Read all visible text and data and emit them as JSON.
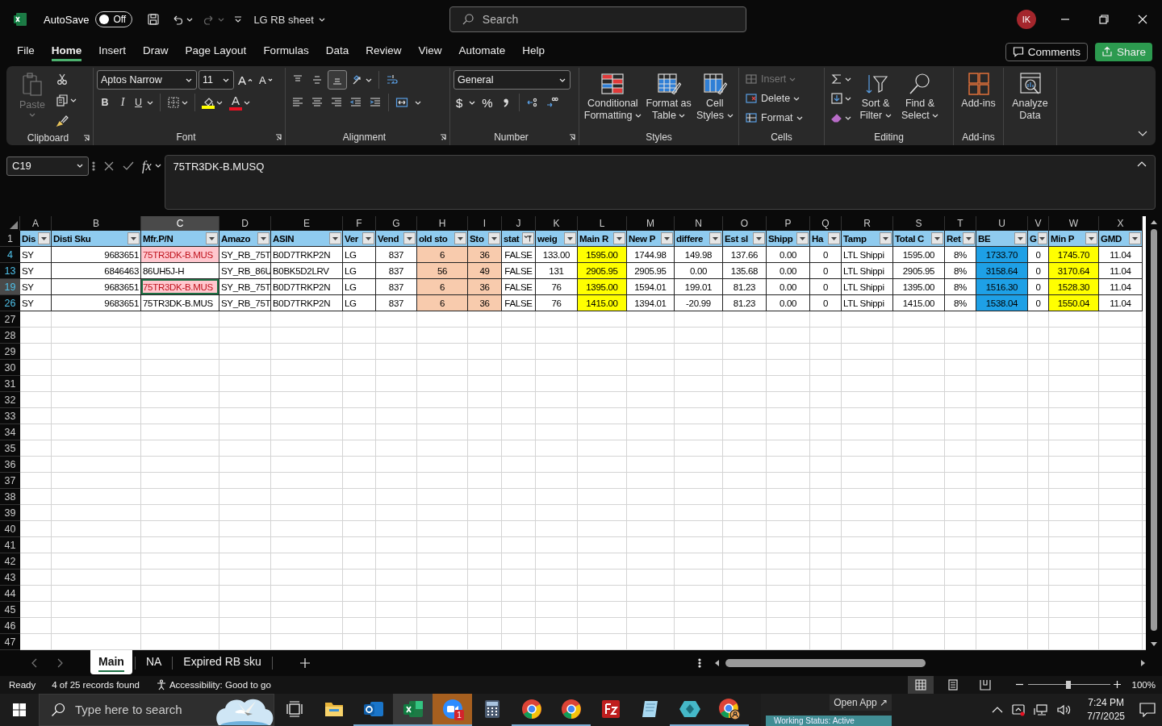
{
  "title_bar": {
    "autosave_label": "AutoSave",
    "autosave": {
      "on": false,
      "label": "Off"
    },
    "document_title": "LG RB sheet",
    "search": {
      "placeholder": "Search"
    },
    "avatar": "IK"
  },
  "menu": {
    "tabs": [
      {
        "label": "File",
        "selected": false
      },
      {
        "label": "Home",
        "selected": true
      },
      {
        "label": "Insert",
        "selected": false
      },
      {
        "label": "Draw",
        "selected": false
      },
      {
        "label": "Page Layout",
        "selected": false
      },
      {
        "label": "Formulas",
        "selected": false
      },
      {
        "label": "Data",
        "selected": false
      },
      {
        "label": "Review",
        "selected": false
      },
      {
        "label": "View",
        "selected": false
      },
      {
        "label": "Automate",
        "selected": false
      },
      {
        "label": "Help",
        "selected": false
      }
    ],
    "comments": "Comments",
    "share": "Share"
  },
  "ribbon": {
    "clipboard": {
      "label": "Clipboard",
      "paste": {
        "label": "Paste",
        "disabled": true
      }
    },
    "font": {
      "label": "Font",
      "font_name": "Aptos Narrow",
      "font_size": "11",
      "grow_font": "A",
      "shrink_font": "A",
      "bold": "B",
      "italic": "I",
      "underline": "U",
      "font_color": "A"
    },
    "alignment": {
      "label": "Alignment"
    },
    "number": {
      "label": "Number",
      "format": "General",
      "currency": "$",
      "percent": "%"
    },
    "styles": {
      "label": "Styles",
      "buttons": [
        "Conditional Formatting",
        "Format as Table",
        "Cell Styles"
      ]
    },
    "cells": {
      "label": "Cells",
      "buttons": [
        {
          "label": "Insert",
          "disabled": true
        },
        {
          "label": "Delete",
          "disabled": false
        },
        {
          "label": "Format",
          "disabled": false
        }
      ]
    },
    "editing": {
      "label": "Editing",
      "buttons": [
        "Sort & Filter",
        "Find & Select"
      ]
    },
    "add_ins": {
      "label": "Add-ins",
      "buttons": [
        "Add-ins"
      ]
    },
    "analysis": {
      "buttons": [
        "Analyze Data"
      ]
    }
  },
  "formula_bar": {
    "name_box": "C19",
    "function_label": "fx",
    "value": "75TR3DK-B.MUSQ"
  },
  "grid": {
    "columns": [
      {
        "letter": "A",
        "selected": false
      },
      {
        "letter": "B",
        "selected": false
      },
      {
        "letter": "C",
        "selected": true
      },
      {
        "letter": "D",
        "selected": false
      },
      {
        "letter": "E",
        "selected": false
      },
      {
        "letter": "F",
        "selected": false
      },
      {
        "letter": "G",
        "selected": false
      },
      {
        "letter": "H",
        "selected": false
      },
      {
        "letter": "I",
        "selected": false
      },
      {
        "letter": "J",
        "selected": false
      },
      {
        "letter": "K",
        "selected": false
      },
      {
        "letter": "L",
        "selected": false
      },
      {
        "letter": "M",
        "selected": false
      },
      {
        "letter": "N",
        "selected": false
      },
      {
        "letter": "O",
        "selected": false
      },
      {
        "letter": "P",
        "selected": false
      },
      {
        "letter": "Q",
        "selected": false
      },
      {
        "letter": "R",
        "selected": false
      },
      {
        "letter": "S",
        "selected": false
      },
      {
        "letter": "T",
        "selected": false
      },
      {
        "letter": "U",
        "selected": false
      },
      {
        "letter": "V",
        "selected": false
      },
      {
        "letter": "W",
        "selected": false
      },
      {
        "letter": "X",
        "selected": false
      }
    ],
    "rows": [
      {
        "number": "1",
        "kind": "header",
        "selected": false,
        "cells": [
          {
            "text": "Dis",
            "filtered": false
          },
          {
            "text": "Disti Sku",
            "filtered": false
          },
          {
            "text": "Mfr.P/N",
            "filtered": false
          },
          {
            "text": "Amazo",
            "filtered": false
          },
          {
            "text": "ASIN",
            "filtered": false
          },
          {
            "text": "Ver",
            "filtered": false
          },
          {
            "text": "Vend",
            "filtered": false
          },
          {
            "text": "old sto",
            "filtered": false
          },
          {
            "text": "Sto",
            "filtered": false
          },
          {
            "text": "stat",
            "filtered": true
          },
          {
            "text": "weig",
            "filtered": false
          },
          {
            "text": "Main R",
            "filtered": false
          },
          {
            "text": "New P",
            "filtered": false
          },
          {
            "text": "differe",
            "filtered": false
          },
          {
            "text": "Est sl",
            "filtered": false
          },
          {
            "text": "Shipp",
            "filtered": false
          },
          {
            "text": "Ha",
            "filtered": false
          },
          {
            "text": "Tamp",
            "filtered": false
          },
          {
            "text": "Total C",
            "filtered": false
          },
          {
            "text": "Ret",
            "filtered": false
          },
          {
            "text": "BE",
            "filtered": false
          },
          {
            "text": "G",
            "filtered": false
          },
          {
            "text": "Min P",
            "filtered": false
          },
          {
            "text": "GMD",
            "filtered": false
          }
        ]
      },
      {
        "number": "4",
        "kind": "data",
        "selected": false,
        "cells": [
          {
            "text": "SY"
          },
          {
            "text": "9683651"
          },
          {
            "text": "75TR3DK-B.MUS",
            "kind": "alert"
          },
          {
            "text": "SY_RB_75T"
          },
          {
            "text": "B0D7TRKP2N"
          },
          {
            "text": "LG"
          },
          {
            "text": "837"
          },
          {
            "text": "6",
            "color": "#f8cbad"
          },
          {
            "text": "36",
            "color": "#f8cbad"
          },
          {
            "text": "FALSE"
          },
          {
            "text": "133.00"
          },
          {
            "text": "1595.00",
            "color": "#ffff00"
          },
          {
            "text": "1744.98"
          },
          {
            "text": "149.98"
          },
          {
            "text": "137.66"
          },
          {
            "text": "0.00"
          },
          {
            "text": "0"
          },
          {
            "text": "LTL Shippi"
          },
          {
            "text": "1595.00"
          },
          {
            "text": "8%"
          },
          {
            "text": "1733.70",
            "color": "#1ea0e6"
          },
          {
            "text": "0"
          },
          {
            "text": "1745.70",
            "color": "#ffff00"
          },
          {
            "text": "11.04"
          }
        ]
      },
      {
        "number": "13",
        "kind": "data",
        "selected": false,
        "cells": [
          {
            "text": "SY"
          },
          {
            "text": "6846463"
          },
          {
            "text": "86UH5J-H"
          },
          {
            "text": "SY_RB_86U"
          },
          {
            "text": "B0BK5D2LRV"
          },
          {
            "text": "LG"
          },
          {
            "text": "837"
          },
          {
            "text": "56",
            "color": "#f8cbad"
          },
          {
            "text": "49",
            "color": "#f8cbad"
          },
          {
            "text": "FALSE"
          },
          {
            "text": "131"
          },
          {
            "text": "2905.95",
            "color": "#ffff00"
          },
          {
            "text": "2905.95"
          },
          {
            "text": "0.00"
          },
          {
            "text": "135.68"
          },
          {
            "text": "0.00"
          },
          {
            "text": "0"
          },
          {
            "text": "LTL Shippi"
          },
          {
            "text": "2905.95"
          },
          {
            "text": "8%"
          },
          {
            "text": "3158.64",
            "color": "#1ea0e6"
          },
          {
            "text": "0"
          },
          {
            "text": "3170.64",
            "color": "#ffff00"
          },
          {
            "text": "11.04"
          }
        ]
      },
      {
        "number": "19",
        "kind": "data",
        "selected": true,
        "cells": [
          {
            "text": "SY"
          },
          {
            "text": "9683651"
          },
          {
            "text": "75TR3DK-B.MUS",
            "kind": "alert"
          },
          {
            "text": "SY_RB_75T"
          },
          {
            "text": "B0D7TRKP2N"
          },
          {
            "text": "LG"
          },
          {
            "text": "837"
          },
          {
            "text": "6",
            "color": "#f8cbad"
          },
          {
            "text": "36",
            "color": "#f8cbad"
          },
          {
            "text": "FALSE"
          },
          {
            "text": "76"
          },
          {
            "text": "1395.00",
            "color": "#ffff00"
          },
          {
            "text": "1594.01"
          },
          {
            "text": "199.01"
          },
          {
            "text": "81.23"
          },
          {
            "text": "0.00"
          },
          {
            "text": "0"
          },
          {
            "text": "LTL Shippi"
          },
          {
            "text": "1395.00"
          },
          {
            "text": "8%"
          },
          {
            "text": "1516.30",
            "color": "#1ea0e6"
          },
          {
            "text": "0"
          },
          {
            "text": "1528.30",
            "color": "#ffff00"
          },
          {
            "text": "11.04"
          }
        ]
      },
      {
        "number": "26",
        "kind": "data",
        "selected": false,
        "cells": [
          {
            "text": "SY"
          },
          {
            "text": "9683651"
          },
          {
            "text": "75TR3DK-B.MUS"
          },
          {
            "text": "SY_RB_75T"
          },
          {
            "text": "B0D7TRKP2N"
          },
          {
            "text": "LG"
          },
          {
            "text": "837"
          },
          {
            "text": "6",
            "color": "#f8cbad"
          },
          {
            "text": "36",
            "color": "#f8cbad"
          },
          {
            "text": "FALSE"
          },
          {
            "text": "76"
          },
          {
            "text": "1415.00",
            "color": "#ffff00"
          },
          {
            "text": "1394.01"
          },
          {
            "text": "-20.99"
          },
          {
            "text": "81.23"
          },
          {
            "text": "0.00"
          },
          {
            "text": "0"
          },
          {
            "text": "LTL Shippi"
          },
          {
            "text": "1415.00"
          },
          {
            "text": "8%"
          },
          {
            "text": "1538.04",
            "color": "#1ea0e6"
          },
          {
            "text": "0"
          },
          {
            "text": "1550.04",
            "color": "#ffff00"
          },
          {
            "text": "11.04"
          }
        ]
      }
    ],
    "empty_rows": [
      "27",
      "28",
      "29",
      "30",
      "31",
      "32",
      "33",
      "34",
      "35",
      "36",
      "37",
      "38",
      "39",
      "40",
      "41",
      "42",
      "43",
      "44",
      "45",
      "46",
      "47"
    ]
  },
  "sheet_tabs": [
    {
      "label": "Main",
      "selected": true
    },
    {
      "label": "NA",
      "selected": false
    },
    {
      "label": "Expired RB sku",
      "selected": false
    }
  ],
  "status_bar": {
    "mode": "Ready",
    "records": "4 of 25 records found",
    "accessibility": "Accessibility: Good to go",
    "views": [
      {
        "selected": true
      },
      {
        "selected": false
      },
      {
        "selected": false
      }
    ],
    "zoom": {
      "level": 0.49
    },
    "zoom_label": "100%"
  },
  "taskbar": {
    "search": {
      "placeholder": "Type here to search"
    },
    "apps": [
      {
        "kind": "task-view",
        "active": false,
        "open": false,
        "flashing": false
      },
      {
        "kind": "folder",
        "active": false,
        "open": false,
        "flashing": false
      },
      {
        "kind": "mail",
        "active": false,
        "open": true,
        "flashing": false
      },
      {
        "kind": "spreadsheet",
        "active": true,
        "open": true,
        "flashing": false
      },
      {
        "kind": "video",
        "active": false,
        "open": true,
        "flashing": true,
        "badge": "1"
      },
      {
        "kind": "calculator",
        "active": false,
        "open": false,
        "flashing": false
      },
      {
        "kind": "browser",
        "active": false,
        "open": true,
        "flashing": false
      },
      {
        "kind": "browser",
        "active": false,
        "open": true,
        "flashing": false
      },
      {
        "kind": "transfer",
        "active": false,
        "open": false,
        "flashing": false
      },
      {
        "kind": "notepad",
        "active": false,
        "open": false,
        "flashing": false
      },
      {
        "kind": "diamond",
        "active": false,
        "open": true,
        "flashing": false
      },
      {
        "kind": "browser-profile",
        "active": false,
        "open": true,
        "flashing": false
      }
    ],
    "open_app": "Open App ↗",
    "work_status": "Working Status: Active",
    "time": "7:24 PM",
    "date": "7/7/2025"
  }
}
